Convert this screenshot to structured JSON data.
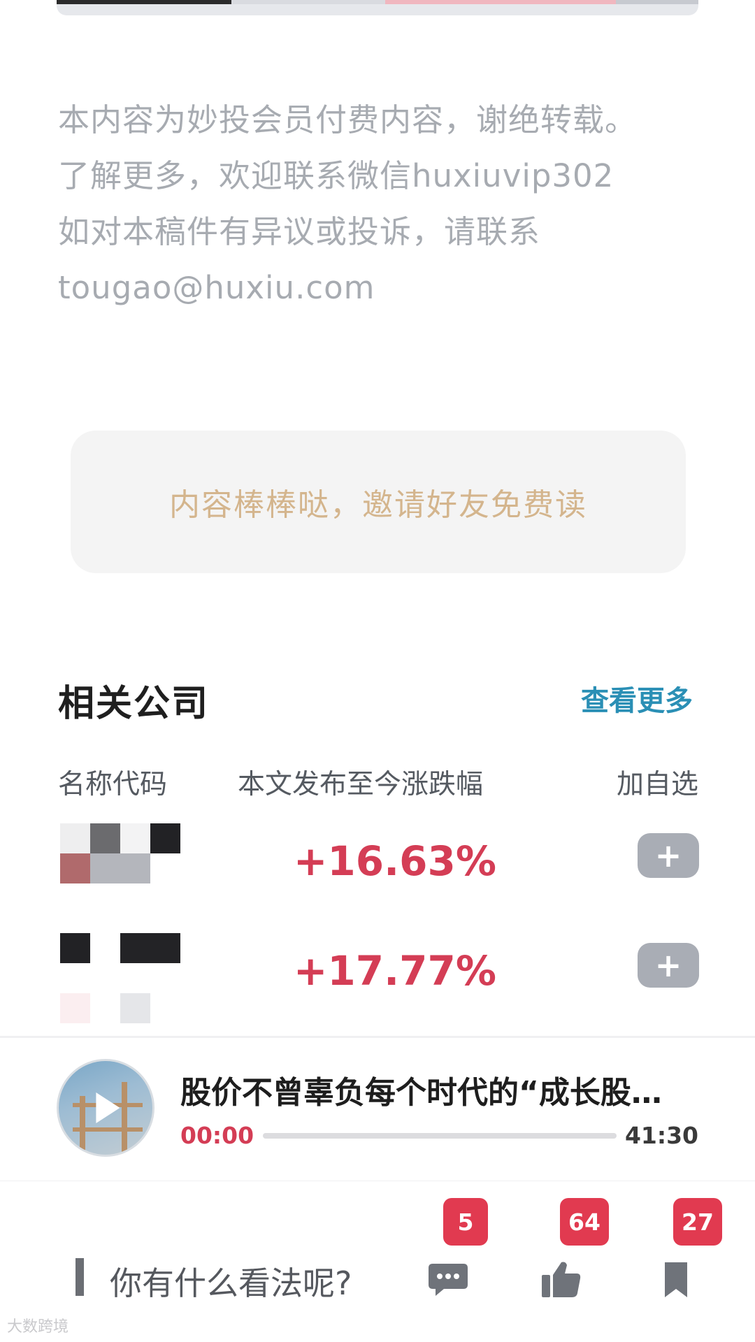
{
  "disclaimer": {
    "line1": "本内容为妙投会员付费内容，谢绝转载。",
    "line2": "了解更多，欢迎联系微信huxiuvip302",
    "line3": "如对本稿件有异议或投诉，请联系",
    "line4": "tougao@huxiu.com"
  },
  "invite": {
    "label": "内容棒棒哒，邀请好友免费读"
  },
  "related_companies": {
    "title": "相关公司",
    "see_more": "查看更多",
    "columns": {
      "name": "名称代码",
      "change": "本文发布至今涨跌幅",
      "add": "加自选"
    },
    "rows": [
      {
        "change": "+16.63%",
        "add_label": "+"
      },
      {
        "change": "+17.77%",
        "add_label": "+"
      }
    ]
  },
  "player": {
    "title": "股价不曾辜负每个时代的“成长股…",
    "current_time": "00:00",
    "total_time": "41:30",
    "progress": 0
  },
  "bottom_bar": {
    "comment_prompt": "你有什么看法呢?",
    "comments_count": "5",
    "likes_count": "64",
    "bookmarks_count": "27"
  },
  "watermark": "大数跨境",
  "colors": {
    "accent_red": "#d43d55",
    "link_blue": "#2a8fb5",
    "invite_gold": "#d4b58d",
    "badge_red": "#e13a50"
  }
}
